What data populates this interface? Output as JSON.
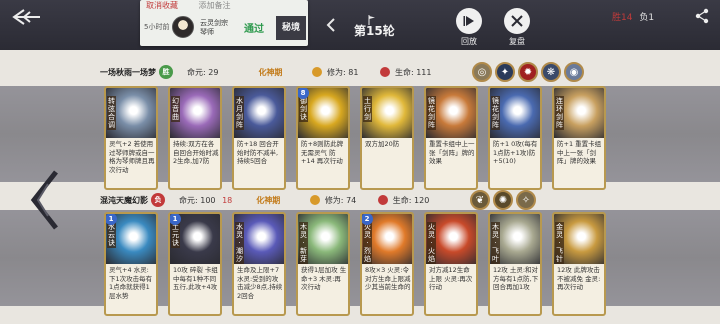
{
  "topbar": {
    "cancel_collect": "取消收藏",
    "add_note": "添加备注",
    "time_ago": "5小时前",
    "opponent_name_line1": "云灵剑宗",
    "opponent_name_line2": "琴师",
    "status": "通过",
    "realm_tag": "秘境",
    "round_label": "第15轮",
    "replay_label": "回放",
    "review_label": "复盘",
    "score_win": "胜14",
    "score_lose": "负1"
  },
  "players": [
    {
      "name": "一场秋雨一场梦",
      "badge": "胜",
      "badge_color": "#4a9a4a",
      "life_label": "命元:",
      "life": "29",
      "realm": "化神期",
      "cultivation_label": "修为:",
      "cultivation": "81",
      "hp_label": "生命:",
      "hp": "111",
      "buffs": [
        "shield-buff",
        "blade-buff",
        "flame-buff",
        "wing-buff",
        "swirl-buff"
      ],
      "cards": [
        {
          "num": "",
          "title": "转弦合调",
          "desc": "灵气+2 若使用过琴师牌或自一格为琴师牌且再次行动",
          "color": "#7a8ea8"
        },
        {
          "num": "",
          "title": "幻音曲",
          "desc": "持续:双方在各自回合开始时减2生命,加7防",
          "color": "#9a6ab8"
        },
        {
          "num": "",
          "title": "水月剑阵",
          "desc": "防+18 回合开始时防不减半,持续5回合",
          "color": "#4a5a9a"
        },
        {
          "num": "8",
          "title": "御剑诀",
          "desc": "防+8则防此牌无需灵气 防+14 再次行动",
          "color": "#d8a820"
        },
        {
          "num": "",
          "title": "土行剑",
          "desc": "双方加20防",
          "color": "#e0b83a"
        },
        {
          "num": "",
          "title": "镜花剑阵",
          "desc": "重置卡组中上一张「剑阵」牌的效果",
          "color": "#c87a3a"
        },
        {
          "num": "",
          "title": "镜花剑阵",
          "desc": "防+1 0攻(每有1点防+1攻)防+5(10)",
          "color": "#4a6ab0"
        },
        {
          "num": "",
          "title": "连环剑阵",
          "desc": "防+1 重置卡组中上一张「剑阵」牌的效果",
          "color": "#c8a060"
        }
      ]
    },
    {
      "name": "混沌天魔幻影",
      "badge": "负",
      "badge_color": "#c23a3a",
      "life_label": "命元:",
      "life": "100",
      "life_extra": "18",
      "realm": "化神期",
      "cultivation_label": "修为:",
      "cultivation": "74",
      "hp_label": "生命:",
      "hp": "120",
      "buffs": [
        "leaf-buff",
        "spark-buff",
        "fan-buff"
      ],
      "cards": [
        {
          "num": "1",
          "title": "水云诀",
          "desc": "灵气+4 水灵:下1次攻击每有1点命就获得1层水势",
          "color": "#3a8ac0"
        },
        {
          "num": "1",
          "title": "土元诀",
          "desc": "10攻 碎裂 卡组中每有1种不同五行,此攻+4攻",
          "color": "#3a3a4a"
        },
        {
          "num": "",
          "title": "水灵·潮汐",
          "desc": "生命及上限+7 水灵:受到的攻击减少8点,持续2回合",
          "color": "#5a5ab8"
        },
        {
          "num": "",
          "title": "木灵·新芽",
          "desc": "获得1层加攻 生命+3 木灵:再次行动",
          "color": "#8ab87a"
        },
        {
          "num": "2",
          "title": "火灵·烈焰",
          "desc": "8攻×3 火灵:令对方生命上限减少其当前生命的",
          "color": "#e07a2a"
        },
        {
          "num": "",
          "title": "火灵·火焰",
          "desc": "对方减12生命上限 火灵:再次行动",
          "color": "#c84a2a"
        },
        {
          "num": "",
          "title": "木灵·飞叶",
          "desc": "12攻 土灵:和对方每有1点防,下回合再加1攻",
          "color": "#a8a890"
        },
        {
          "num": "",
          "title": "金灵·飞针",
          "desc": "12攻 此牌攻击不被减免 金灵:再次行动",
          "color": "#c89a40"
        }
      ]
    }
  ]
}
